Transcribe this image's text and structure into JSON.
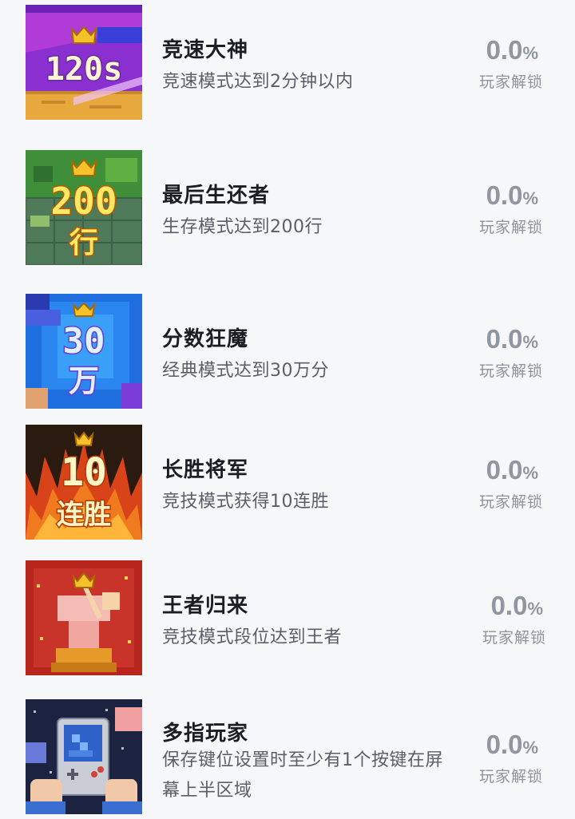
{
  "achievements": [
    {
      "badge_icon": "speed-120s-badge-icon",
      "badge_line1": "120s",
      "badge_line2": "",
      "title": "竞速大神",
      "description": "竞速模式达到2分钟以内",
      "percent": "0.0",
      "percent_unit": "%",
      "unlock_label": "玩家解锁"
    },
    {
      "badge_icon": "survival-200-lines-badge-icon",
      "badge_line1": "200",
      "badge_line2": "行",
      "title": "最后生还者",
      "description": "生存模式达到200行",
      "percent": "0.0",
      "percent_unit": "%",
      "unlock_label": "玩家解锁"
    },
    {
      "badge_icon": "score-300k-badge-icon",
      "badge_line1": "30",
      "badge_line2": "万",
      "title": "分数狂魔",
      "description": "经典模式达到30万分",
      "percent": "0.0",
      "percent_unit": "%",
      "unlock_label": "玩家解锁"
    },
    {
      "badge_icon": "win-streak-10-badge-icon",
      "badge_line1": "10",
      "badge_line2": "连胜",
      "title": "长胜将军",
      "description": "竞技模式获得10连胜",
      "percent": "0.0",
      "percent_unit": "%",
      "unlock_label": "玩家解锁"
    },
    {
      "badge_icon": "king-trophy-badge-icon",
      "badge_line1": "",
      "badge_line2": "",
      "title": "王者归来",
      "description": "竞技模式段位达到王者",
      "percent": "0.0",
      "percent_unit": "%",
      "unlock_label": "玩家解锁"
    },
    {
      "badge_icon": "multi-finger-gamer-badge-icon",
      "badge_line1": "",
      "badge_line2": "",
      "title": "多指玩家",
      "description": "保存键位设置时至少有1个按键在屏幕上半区域",
      "percent": "0.0",
      "percent_unit": "%",
      "unlock_label": "玩家解锁"
    }
  ]
}
